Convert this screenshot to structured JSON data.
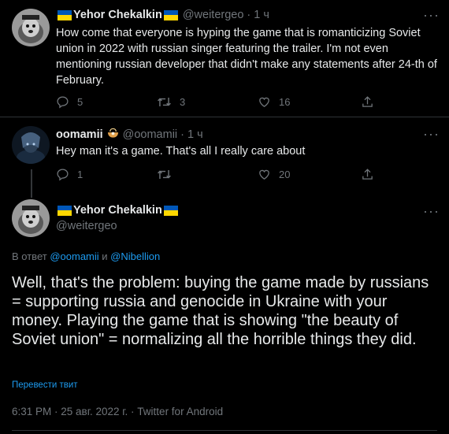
{
  "tweets": [
    {
      "display_name": "Yehor Chekalkin",
      "handle": "@weitergeo",
      "separator": "·",
      "time": "1 ч",
      "text": "How come that everyone is hyping the game that is romanticizing Soviet union in 2022 with russian singer featuring the trailer. I'm not even mentioning russian developer that didn't make any statements after 24-th of February.",
      "replies": "5",
      "retweets": "3",
      "likes": "16"
    },
    {
      "display_name": "oomamii",
      "handle": "@oomamii",
      "separator": "·",
      "time": "1 ч",
      "text": "Hey man it's a game. That's all I really care about",
      "replies": "1",
      "retweets": "",
      "likes": "20"
    }
  ],
  "main_tweet": {
    "display_name": "Yehor Chekalkin",
    "handle": "@weitergeo",
    "reply_prefix": "В ответ",
    "reply_user1": "@oomamii",
    "reply_and": "и",
    "reply_user2": "@Nibellion",
    "text": "Well, that's the problem: buying the game made by russians = supporting russia and genocide in Ukraine with your money. Playing the game that is showing \"the beauty of Soviet union\" = normalizing all the horrible things they did.",
    "translate_label": "Перевести твит",
    "meta": "6:31 PM · 25 авг. 2022 г. · Twitter for Android"
  },
  "icons": {
    "more": "more-dots-icon",
    "reply": "reply-icon",
    "retweet": "retweet-icon",
    "like": "heart-icon",
    "share": "share-icon",
    "flag": "ukraine-flag-icon",
    "emoji": "ramen-bowl-icon"
  },
  "colors": {
    "background": "#000000",
    "text": "#e7e9ea",
    "muted": "#71767b",
    "link": "#1d9bf0",
    "flag_blue": "#0057b7",
    "flag_yellow": "#ffd700"
  }
}
